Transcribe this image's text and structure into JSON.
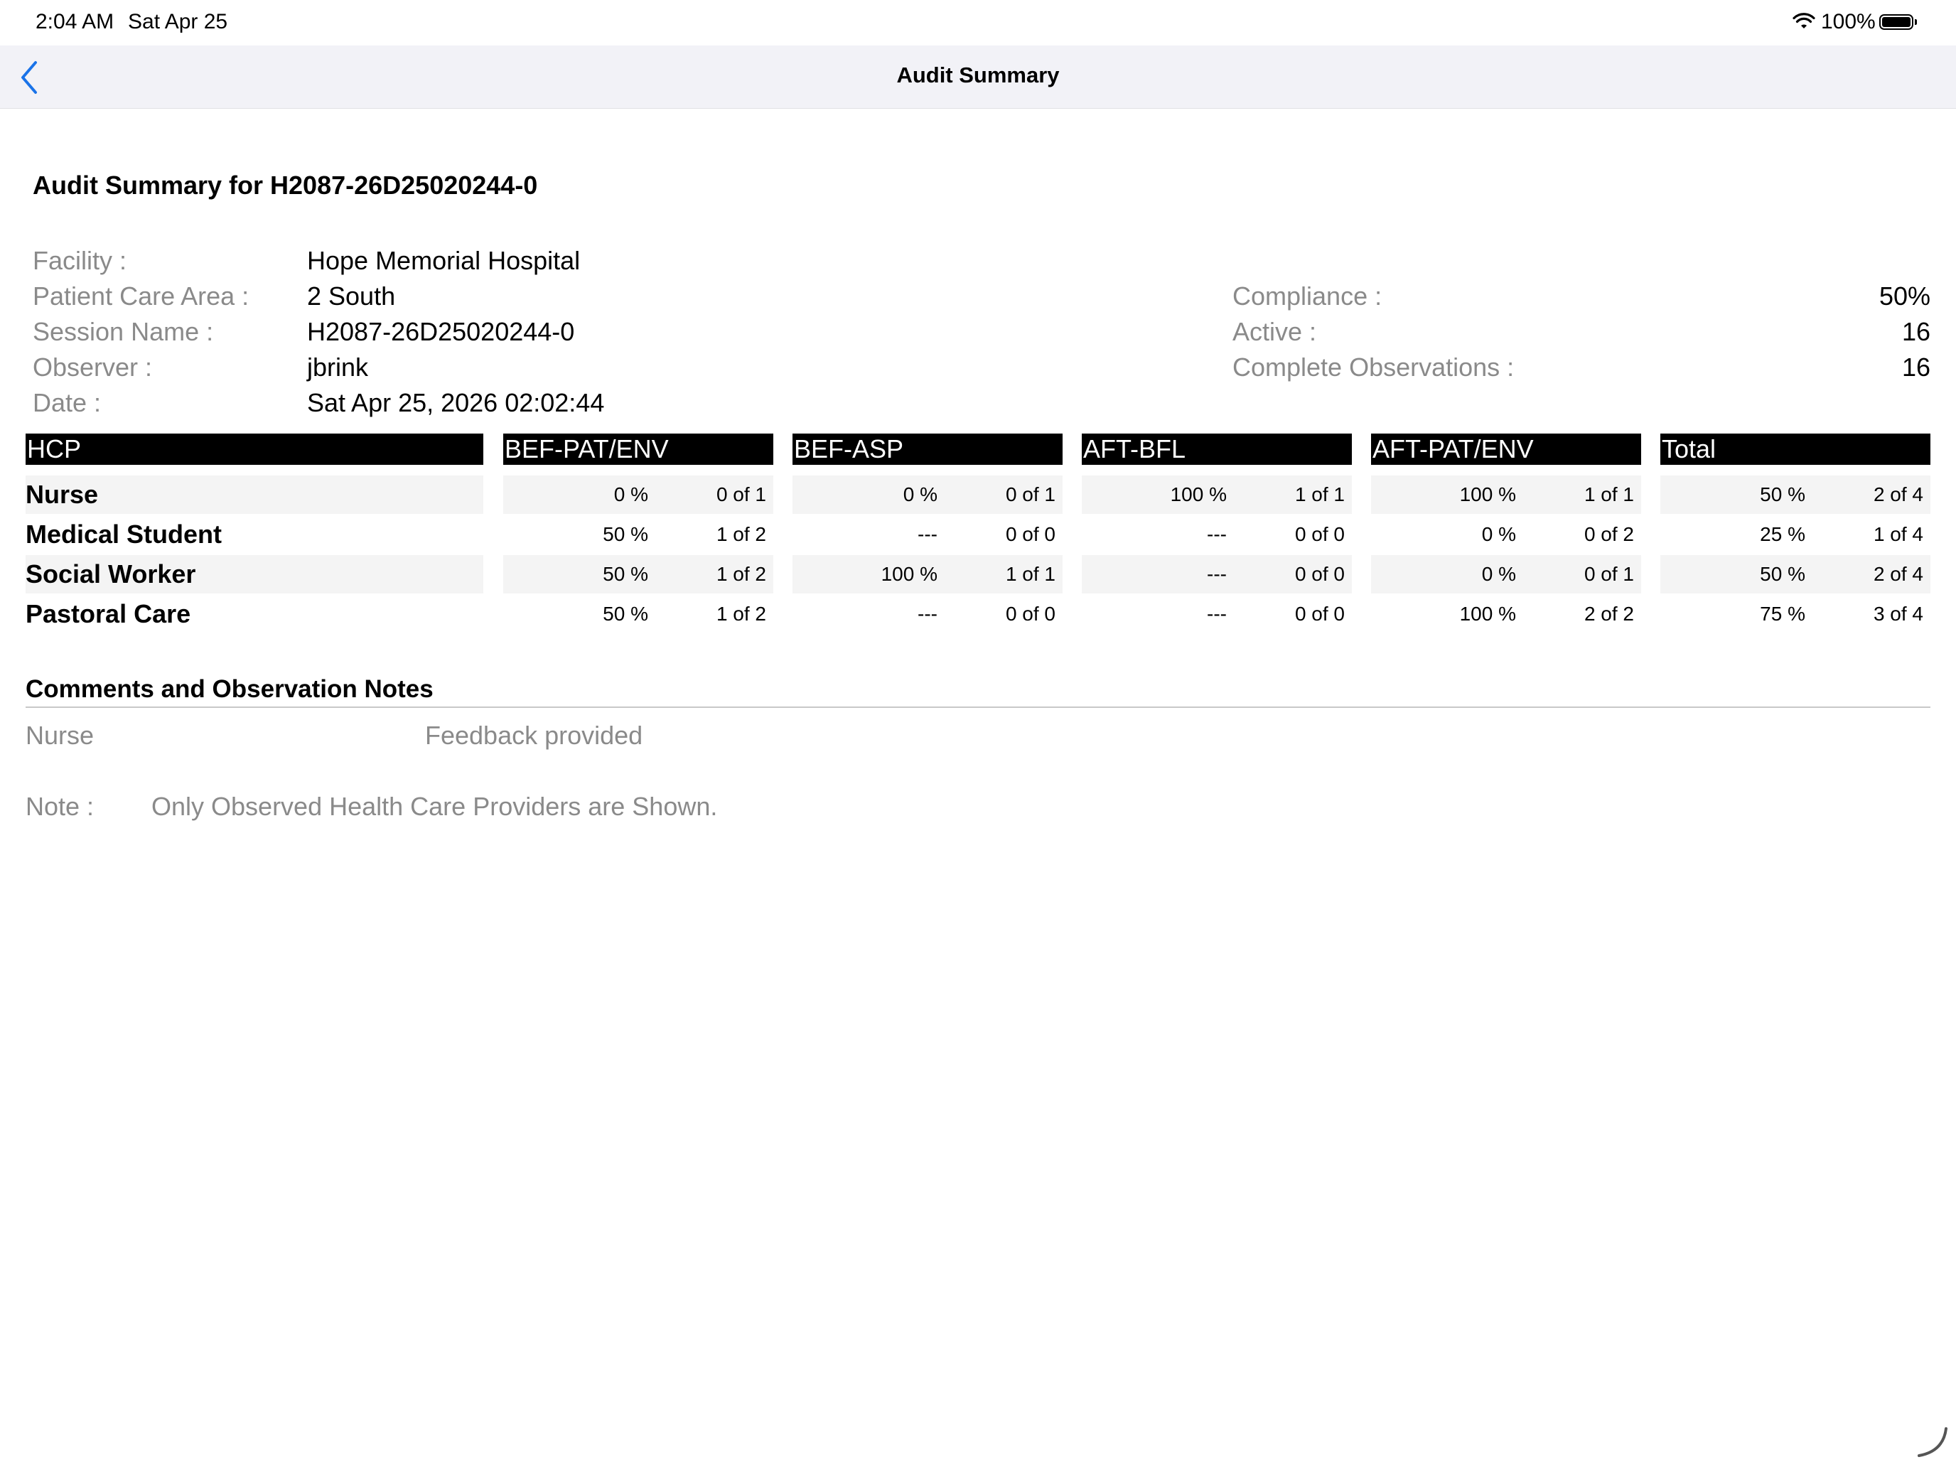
{
  "status_bar": {
    "time": "2:04 AM",
    "date": "Sat Apr 25",
    "battery": "100%",
    "icons": [
      "wifi-icon",
      "battery-icon"
    ]
  },
  "nav": {
    "title": "Audit Summary",
    "back_icon": "chevron-left-icon"
  },
  "heading": "Audit Summary for H2087-26D25020244-0",
  "info": {
    "facility_label": "Facility :",
    "facility": "Hope Memorial Hospital",
    "area_label": "Patient Care Area :",
    "area": "2 South",
    "session_label": "Session Name :",
    "session": "H2087-26D25020244-0",
    "observer_label": "Observer :",
    "observer": "jbrink",
    "date_label": "Date :",
    "date": "Sat Apr 25, 2026 02:02:44"
  },
  "metrics": {
    "compliance_label": "Compliance :",
    "compliance": "50%",
    "active_label": "Active :",
    "active": "16",
    "complete_label": "Complete Observations :",
    "complete": "16"
  },
  "table": {
    "headers": [
      "HCP",
      "BEF-PAT/ENV",
      "BEF-ASP",
      "AFT-BFL",
      "AFT-PAT/ENV",
      "Total"
    ],
    "rows": [
      {
        "hcp": "Nurse",
        "cells": [
          {
            "pct": "0 %",
            "count": "0 of 1"
          },
          {
            "pct": "0 %",
            "count": "0 of 1"
          },
          {
            "pct": "100 %",
            "count": "1 of 1"
          },
          {
            "pct": "100 %",
            "count": "1 of 1"
          },
          {
            "pct": "50 %",
            "count": "2 of 4"
          }
        ]
      },
      {
        "hcp": "Medical Student",
        "cells": [
          {
            "pct": "50 %",
            "count": "1 of 2"
          },
          {
            "pct": "---",
            "count": "0 of 0"
          },
          {
            "pct": "---",
            "count": "0 of 0"
          },
          {
            "pct": "0 %",
            "count": "0 of 2"
          },
          {
            "pct": "25 %",
            "count": "1 of 4"
          }
        ]
      },
      {
        "hcp": "Social Worker",
        "cells": [
          {
            "pct": "50 %",
            "count": "1 of 2"
          },
          {
            "pct": "100 %",
            "count": "1 of 1"
          },
          {
            "pct": "---",
            "count": "0 of 0"
          },
          {
            "pct": "0 %",
            "count": "0 of 1"
          },
          {
            "pct": "50 %",
            "count": "2 of 4"
          }
        ]
      },
      {
        "hcp": "Pastoral Care",
        "cells": [
          {
            "pct": "50 %",
            "count": "1 of 2"
          },
          {
            "pct": "---",
            "count": "0 of 0"
          },
          {
            "pct": "---",
            "count": "0 of 0"
          },
          {
            "pct": "100 %",
            "count": "2 of 2"
          },
          {
            "pct": "75 %",
            "count": "3 of 4"
          }
        ]
      }
    ]
  },
  "comments": {
    "title": "Comments and Observation Notes",
    "items": [
      {
        "who": "Nurse",
        "text": "Feedback provided"
      }
    ]
  },
  "note": {
    "label": "Note :",
    "text": "Only Observed Health Care Providers are Shown."
  },
  "colors": {
    "accent": "#1a73e8",
    "header_bg": "#000000",
    "label_gray": "#8a8a8a",
    "row_shade": "#f4f4f4"
  }
}
